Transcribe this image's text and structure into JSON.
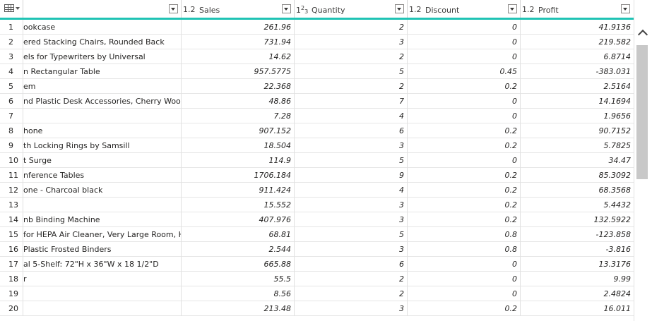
{
  "colors": {
    "accent": "#20c3b4",
    "grid_line": "#e1e1e1",
    "scroll_thumb": "#c8c8c8"
  },
  "header": {
    "corner_icon": "table-icon",
    "columns": [
      {
        "type": "1.2",
        "label": "Sales"
      },
      {
        "type_main": "1",
        "type_sup": "2",
        "type_sub": "3",
        "label": "Quantity"
      },
      {
        "type": "1.2",
        "label": "Discount"
      },
      {
        "type": "1.2",
        "label": "Profit"
      }
    ]
  },
  "rows": [
    {
      "index": "1",
      "name": "ookcase",
      "sales": "261.96",
      "quantity": "2",
      "discount": "0",
      "profit": "41.9136"
    },
    {
      "index": "2",
      "name": "ered Stacking Chairs, Rounded Back",
      "sales": "731.94",
      "quantity": "3",
      "discount": "0",
      "profit": "219.582"
    },
    {
      "index": "3",
      "name": "els for Typewriters by Universal",
      "sales": "14.62",
      "quantity": "2",
      "discount": "0",
      "profit": "6.8714"
    },
    {
      "index": "4",
      "name": "n Rectangular Table",
      "sales": "957.5775",
      "quantity": "5",
      "discount": "0.45",
      "profit": "-383.031"
    },
    {
      "index": "5",
      "name": "em",
      "sales": "22.368",
      "quantity": "2",
      "discount": "0.2",
      "profit": "2.5164"
    },
    {
      "index": "6",
      "name": "nd Plastic Desk Accessories, Cherry Wood",
      "sales": "48.86",
      "quantity": "7",
      "discount": "0",
      "profit": "14.1694"
    },
    {
      "index": "7",
      "name": "",
      "sales": "7.28",
      "quantity": "4",
      "discount": "0",
      "profit": "1.9656"
    },
    {
      "index": "8",
      "name": "hone",
      "sales": "907.152",
      "quantity": "6",
      "discount": "0.2",
      "profit": "90.7152"
    },
    {
      "index": "9",
      "name": "th Locking Rings by Samsill",
      "sales": "18.504",
      "quantity": "3",
      "discount": "0.2",
      "profit": "5.7825"
    },
    {
      "index": "10",
      "name": "t Surge",
      "sales": "114.9",
      "quantity": "5",
      "discount": "0",
      "profit": "34.47"
    },
    {
      "index": "11",
      "name": "nference Tables",
      "sales": "1706.184",
      "quantity": "9",
      "discount": "0.2",
      "profit": "85.3092"
    },
    {
      "index": "12",
      "name": "one - Charcoal black",
      "sales": "911.424",
      "quantity": "4",
      "discount": "0.2",
      "profit": "68.3568"
    },
    {
      "index": "13",
      "name": "",
      "sales": "15.552",
      "quantity": "3",
      "discount": "0.2",
      "profit": "5.4432"
    },
    {
      "index": "14",
      "name": "nb Binding Machine",
      "sales": "407.976",
      "quantity": "3",
      "discount": "0.2",
      "profit": "132.5922"
    },
    {
      "index": "15",
      "name": " for HEPA Air Cleaner, Very Large Room, HE...",
      "sales": "68.81",
      "quantity": "5",
      "discount": "0.8",
      "profit": "-123.858"
    },
    {
      "index": "16",
      "name": "Plastic Frosted Binders",
      "sales": "2.544",
      "quantity": "3",
      "discount": "0.8",
      "profit": "-3.816"
    },
    {
      "index": "17",
      "name": "al 5-Shelf: 72\"H x 36\"W x 18 1/2\"D",
      "sales": "665.88",
      "quantity": "6",
      "discount": "0",
      "profit": "13.3176"
    },
    {
      "index": "18",
      "name": "r",
      "sales": "55.5",
      "quantity": "2",
      "discount": "0",
      "profit": "9.99"
    },
    {
      "index": "19",
      "name": "",
      "sales": "8.56",
      "quantity": "2",
      "discount": "0",
      "profit": "2.4824"
    },
    {
      "index": "20",
      "name": "",
      "sales": "213.48",
      "quantity": "3",
      "discount": "0.2",
      "profit": "16.011"
    }
  ]
}
